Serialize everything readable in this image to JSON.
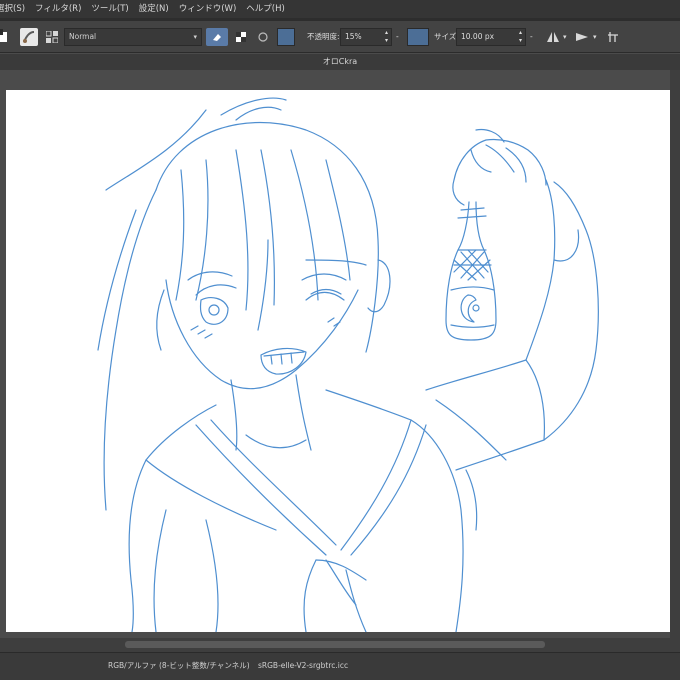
{
  "menu": {
    "items": [
      "選択(S)",
      "フィルタ(R)",
      "ツール(T)",
      "設定(N)",
      "ウィンドウ(W)",
      "ヘルプ(H)"
    ]
  },
  "toolbar": {
    "blend_mode": "Normal",
    "opacity_label": "不透明度:",
    "opacity_value": "15%",
    "size_label": "サイズ:",
    "size_value": "10.00 px",
    "brush_color": "#4c6e96"
  },
  "document": {
    "title": "オロCkra"
  },
  "status": {
    "color_space": "RGB/アルファ (8-ビット整数/チャンネル)",
    "profile": "sRGB-elle-V2-srgbtrc.icc"
  },
  "sketch": {
    "stroke_color": "#4f8fd0"
  }
}
